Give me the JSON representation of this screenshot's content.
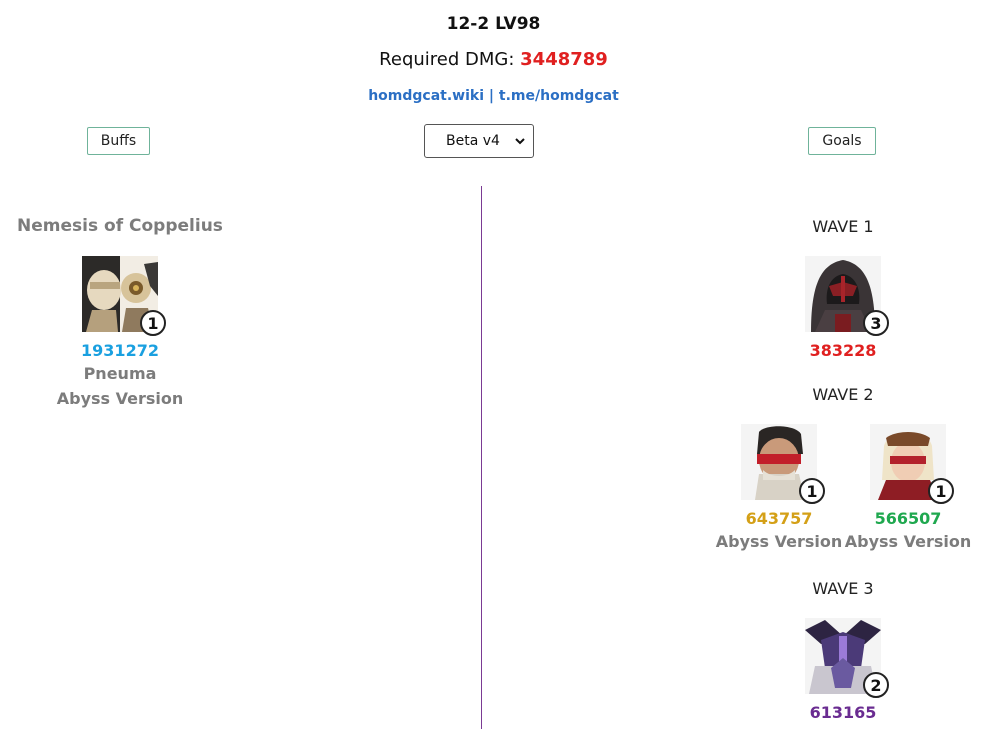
{
  "header": {
    "title": "12-2 LV98",
    "dmg_label": "Required DMG: ",
    "dmg_value": "3448789",
    "link_wiki": "homdgcat.wiki",
    "link_sep": " | ",
    "link_tg": "t.me/homdgcat"
  },
  "controls": {
    "buffs_label": "Buffs",
    "version_selected": "Beta v4",
    "goals_label": "Goals"
  },
  "left": {
    "team_name": "Nemesis of Coppelius",
    "unit": {
      "count": "1",
      "dmg": "1931272",
      "dmg_color": "#1aa0e0",
      "name": "Pneuma",
      "version": "Abyss Version"
    }
  },
  "waves": [
    {
      "label": "WAVE 1",
      "units": [
        {
          "count": "3",
          "dmg": "383228",
          "dmg_color": "#e02020"
        }
      ]
    },
    {
      "label": "WAVE 2",
      "units": [
        {
          "count": "1",
          "dmg": "643757",
          "dmg_color": "#d4a017",
          "version": "Abyss Version"
        },
        {
          "count": "1",
          "dmg": "566507",
          "dmg_color": "#1fa84f",
          "version": "Abyss Version"
        }
      ]
    },
    {
      "label": "WAVE 3",
      "units": [
        {
          "count": "2",
          "dmg": "613165",
          "dmg_color": "#6a2c91"
        }
      ]
    }
  ],
  "icons": {
    "select_arrow": "chevron-down-icon"
  }
}
